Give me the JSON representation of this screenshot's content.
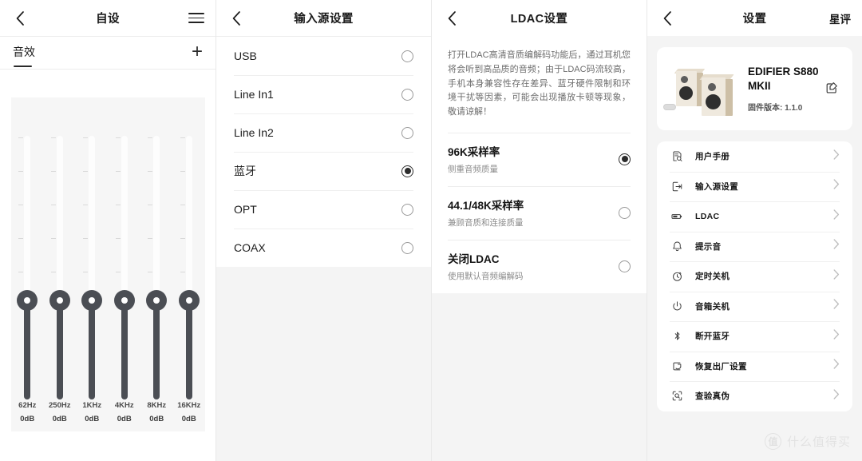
{
  "colors": {
    "accent_dark": "#4b4e54",
    "panel_bg": "#f4f4f4",
    "card_bg": "#ffffff",
    "text_primary": "#1b1b1b",
    "text_muted": "#8c8c8c"
  },
  "panel_eq": {
    "nav": {
      "title": "自设",
      "back_icon": "chevron-left-icon",
      "menu_icon": "hamburger-icon"
    },
    "tab": {
      "label": "音效",
      "add_icon": "plus-icon"
    },
    "bands": [
      {
        "freq": "62Hz",
        "gain": "0dB"
      },
      {
        "freq": "250Hz",
        "gain": "0dB"
      },
      {
        "freq": "1KHz",
        "gain": "0dB"
      },
      {
        "freq": "4KHz",
        "gain": "0dB"
      },
      {
        "freq": "8KHz",
        "gain": "0dB"
      },
      {
        "freq": "16KHz",
        "gain": "0dB"
      }
    ]
  },
  "panel_input": {
    "nav": {
      "title": "输入源设置",
      "back_icon": "chevron-left-icon"
    },
    "options": [
      {
        "label": "USB",
        "selected": false
      },
      {
        "label": "Line In1",
        "selected": false
      },
      {
        "label": "Line In2",
        "selected": false
      },
      {
        "label": "蓝牙",
        "selected": true
      },
      {
        "label": "OPT",
        "selected": false
      },
      {
        "label": "COAX",
        "selected": false
      }
    ]
  },
  "panel_ldac": {
    "nav": {
      "title": "LDAC设置",
      "back_icon": "chevron-left-icon"
    },
    "description": "打开LDAC高清音质编解码功能后，通过耳机您将会听到高品质的音频；由于LDAC码流较高，手机本身兼容性存在差异、蓝牙硬件限制和环境干扰等因素，可能会出现播放卡顿等现象，敬请谅解！",
    "options": [
      {
        "title": "96K采样率",
        "subtitle": "侧重音频质量",
        "selected": true
      },
      {
        "title": "44.1/48K采样率",
        "subtitle": "兼顾音质和连接质量",
        "selected": false
      },
      {
        "title": "关闭LDAC",
        "subtitle": "使用默认音频编解码",
        "selected": false
      }
    ]
  },
  "panel_settings": {
    "nav": {
      "title": "设置",
      "back_icon": "chevron-left-icon",
      "action_label": "星评"
    },
    "device": {
      "name": "EDIFIER S880 MKII",
      "firmware": "固件版本: 1.1.0",
      "edit_icon": "edit-square-icon",
      "image_icon": "bookshelf-speakers-image"
    },
    "menu": [
      {
        "label": "用户手册",
        "icon": "document-search-icon"
      },
      {
        "label": "输入源设置",
        "icon": "input-source-icon"
      },
      {
        "label": "LDAC",
        "icon": "chip-icon"
      },
      {
        "label": "提示音",
        "icon": "bell-icon"
      },
      {
        "label": "定时关机",
        "icon": "timer-icon"
      },
      {
        "label": "音箱关机",
        "icon": "power-icon"
      },
      {
        "label": "断开蓝牙",
        "icon": "bluetooth-icon"
      },
      {
        "label": "恢复出厂设置",
        "icon": "restore-icon"
      },
      {
        "label": "查验真伪",
        "icon": "scan-search-icon"
      }
    ]
  },
  "watermark": {
    "logo_text": "值",
    "text": "什么值得买"
  }
}
